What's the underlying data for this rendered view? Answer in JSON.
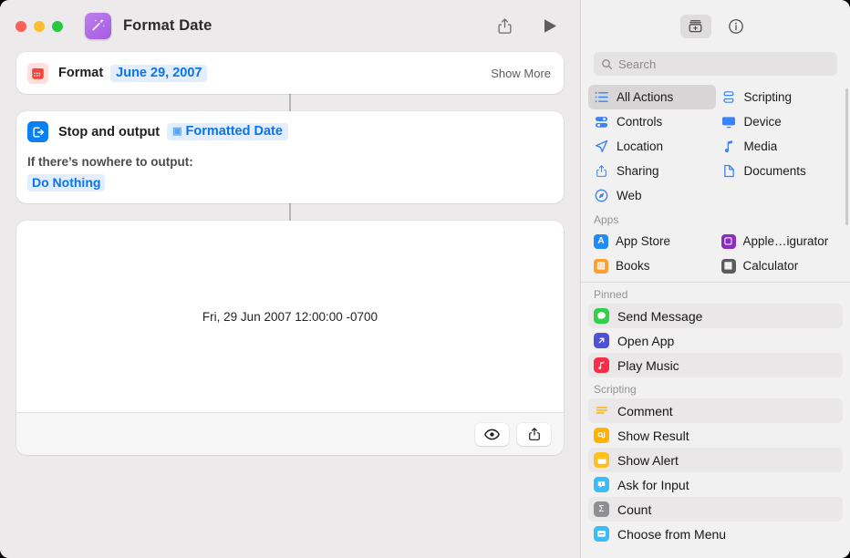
{
  "window": {
    "title": "Format Date",
    "app_icon": "magic-wand-icon",
    "traffic_lights": [
      "close",
      "minimize",
      "zoom"
    ],
    "toolbar": {
      "share_label": "share-icon",
      "run_label": "run-icon"
    }
  },
  "editor": {
    "actions": [
      {
        "icon": "calendar-icon",
        "label": "Format",
        "token": "June 29, 2007",
        "trailing": "Show More"
      },
      {
        "icon": "stop-output-icon",
        "label": "Stop and output",
        "token": "Formatted Date",
        "sub_label": "If there’s nowhere to output:",
        "choice": "Do Nothing"
      }
    ],
    "result": {
      "text": "Fri, 29 Jun 2007 12:00:00 -0700",
      "buttons": [
        {
          "name": "quick-look-button",
          "icon": "eye-icon"
        },
        {
          "name": "share-result-button",
          "icon": "share-icon"
        }
      ]
    }
  },
  "sidebar": {
    "toolbar": [
      {
        "name": "action-library-button",
        "icon": "library-icon",
        "active": true
      },
      {
        "name": "info-button",
        "icon": "info-circle-icon",
        "active": false
      }
    ],
    "search": {
      "placeholder": "Search",
      "value": ""
    },
    "categories": [
      {
        "label": "All Actions",
        "icon": "list-bullet-icon",
        "selected": true
      },
      {
        "label": "Scripting",
        "icon": "scroll-icon",
        "selected": false
      },
      {
        "label": "Controls",
        "icon": "controls-icon",
        "selected": false
      },
      {
        "label": "Device",
        "icon": "display-icon",
        "selected": false
      },
      {
        "label": "Location",
        "icon": "location-arrow-icon",
        "selected": false
      },
      {
        "label": "Media",
        "icon": "music-note-icon",
        "selected": false
      },
      {
        "label": "Sharing",
        "icon": "share-icon",
        "selected": false
      },
      {
        "label": "Documents",
        "icon": "document-icon",
        "selected": false
      },
      {
        "label": "Web",
        "icon": "compass-icon",
        "selected": false
      }
    ],
    "sections": [
      {
        "title": "Apps",
        "layout": "grid",
        "items": [
          {
            "label": "App Store",
            "icon": "app-store-icon",
            "color": "#1e8dfa"
          },
          {
            "label": "Apple…igurator",
            "icon": "apple-configurator-icon",
            "color": "#8a2ec0"
          },
          {
            "label": "Books",
            "icon": "books-icon",
            "color": "#ff9f2e"
          },
          {
            "label": "Calculator",
            "icon": "calculator-icon",
            "color": "#5b5b5b"
          }
        ]
      },
      {
        "title": "Pinned",
        "layout": "list",
        "items": [
          {
            "label": "Send Message",
            "icon": "messages-icon",
            "color": "#32d04a"
          },
          {
            "label": "Open App",
            "icon": "open-app-icon",
            "color": "#4e51d8"
          },
          {
            "label": "Play Music",
            "icon": "music-icon",
            "color": "#fa2d48"
          }
        ]
      },
      {
        "title": "Scripting",
        "layout": "list",
        "items": [
          {
            "label": "Comment",
            "icon": "comment-icon",
            "color": "#ffb300"
          },
          {
            "label": "Show Result",
            "icon": "show-result-icon",
            "color": "#ffb300"
          },
          {
            "label": "Show Alert",
            "icon": "show-alert-icon",
            "color": "#ffc01e"
          },
          {
            "label": "Ask for Input",
            "icon": "ask-input-icon",
            "color": "#37bdf8"
          },
          {
            "label": "Count",
            "icon": "count-icon",
            "color": "#8e8e93"
          },
          {
            "label": "Choose from Menu",
            "icon": "choose-menu-icon",
            "color": "#37bdf8"
          }
        ]
      }
    ]
  },
  "colors": {
    "accent_blue": "#0a74e8",
    "token_bg": "#e2edfd",
    "canvas": "#eceaea",
    "sidebar": "#f2f1f1"
  }
}
